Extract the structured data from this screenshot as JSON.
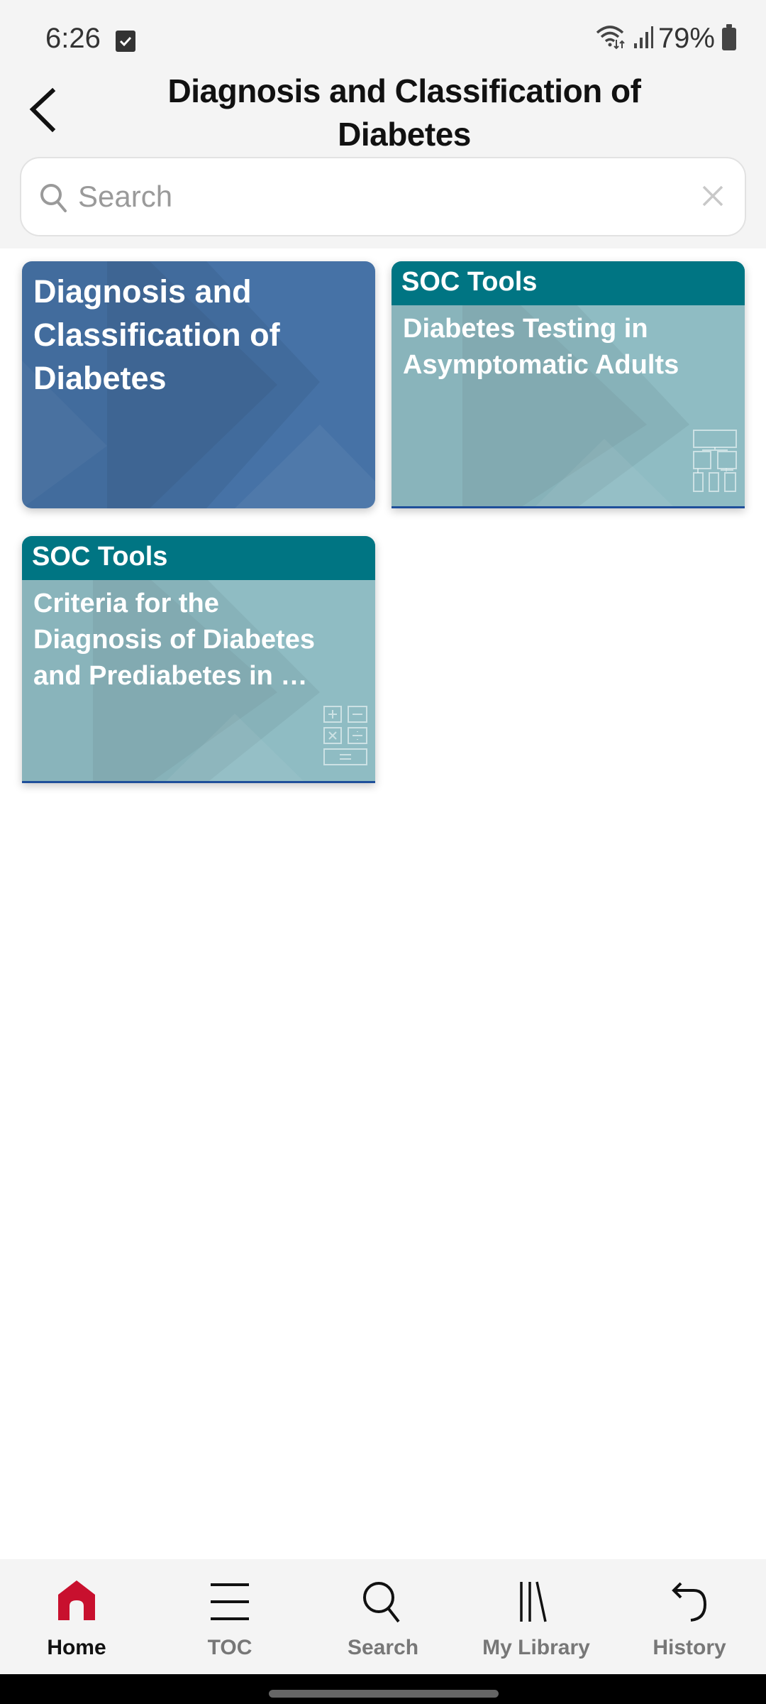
{
  "status_bar": {
    "time": "6:26",
    "battery_percent": "79%",
    "icons": [
      "checkbox-notification-icon",
      "wifi-icon",
      "signal-icon",
      "battery-icon"
    ]
  },
  "header": {
    "title": "Diagnosis and Classification of Diabetes",
    "back_icon": "chevron-left-icon"
  },
  "search": {
    "placeholder": "Search",
    "value": "",
    "icon": "search-icon",
    "clear_icon": "close-icon"
  },
  "cards": [
    {
      "type": "chapter",
      "title": "Diagnosis and Classification of Diabetes",
      "color": "#4672a6"
    },
    {
      "type": "tool",
      "header": "SOC Tools",
      "title": "Diabetes Testing in Asymptomatic Adults",
      "icon": "flowchart-icon",
      "header_color": "#007583",
      "color": "#8fbcc3"
    },
    {
      "type": "tool",
      "header": "SOC Tools",
      "title": "Criteria for the Diagnosis of Diabetes and Prediabetes in …",
      "icon": "calculator-icon",
      "header_color": "#007583",
      "color": "#8fbcc3"
    }
  ],
  "bottom_nav": {
    "items": [
      {
        "label": "Home",
        "icon": "home-icon",
        "active": true
      },
      {
        "label": "TOC",
        "icon": "menu-icon",
        "active": false
      },
      {
        "label": "Search",
        "icon": "search-icon",
        "active": false
      },
      {
        "label": "My Library",
        "icon": "library-icon",
        "active": false
      },
      {
        "label": "History",
        "icon": "undo-icon",
        "active": false
      }
    ],
    "active_color": "#c8102e"
  }
}
